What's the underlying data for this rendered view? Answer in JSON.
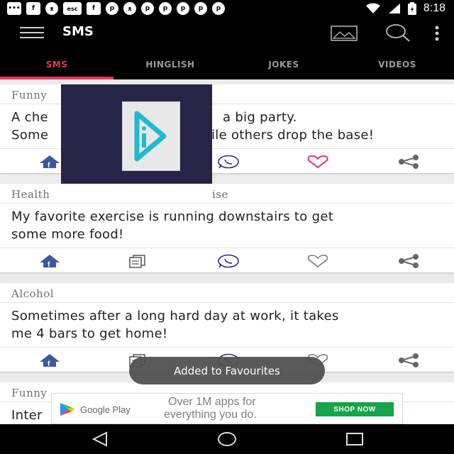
{
  "statusbar": {
    "left_icons": [
      "messenger-icon",
      "facebook-icon",
      "cat-icon",
      "esc-icon",
      "facebook-icon",
      "pinterest-icon",
      "cat-icon",
      "pinterest-icon",
      "pinterest-icon",
      "pinterest-icon",
      "pinterest-icon",
      "pinterest-icon"
    ],
    "esc_label": "esc",
    "time": "8:18"
  },
  "appbar": {
    "title": "SMS",
    "icons": [
      "menu-icon",
      "image-icon",
      "search-icon",
      "more-vert-icon"
    ]
  },
  "tabs": [
    {
      "label": "SMS",
      "active": true
    },
    {
      "label": "HINGLISH",
      "active": false
    },
    {
      "label": "JOKES",
      "active": false
    },
    {
      "label": "VIDEOS",
      "active": false
    }
  ],
  "cards": [
    {
      "category": "Funny",
      "lines": [
        "A che",
        "Some"
      ],
      "lines_right": [
        "a big party.",
        "ile others drop the base!"
      ],
      "favourited": true
    },
    {
      "category": "Health",
      "category_right": "ise",
      "lines": [
        "My favorite exercise is running downstairs to get",
        "some more food!"
      ],
      "favourited": false
    },
    {
      "category": "Alcohol",
      "lines": [
        "Sometimes after a long hard day at work, it takes",
        "me 4 bars to get home!"
      ],
      "favourited": false
    },
    {
      "category": "Funny",
      "lines": [
        "Inter"
      ]
    }
  ],
  "toast": "Added to Favourites",
  "ad": {
    "brand": "Google Play",
    "line1": "Over 1M apps for",
    "line2": "everything you do.",
    "button": "SHOP NOW"
  },
  "navbar": {
    "icons": [
      "back-icon",
      "home-icon",
      "recents-icon"
    ]
  },
  "colors": {
    "accent": "#e8365c",
    "share": "#3c5a9a",
    "whatsapp": "#2b2b8a",
    "ad_button": "#16a34a"
  }
}
